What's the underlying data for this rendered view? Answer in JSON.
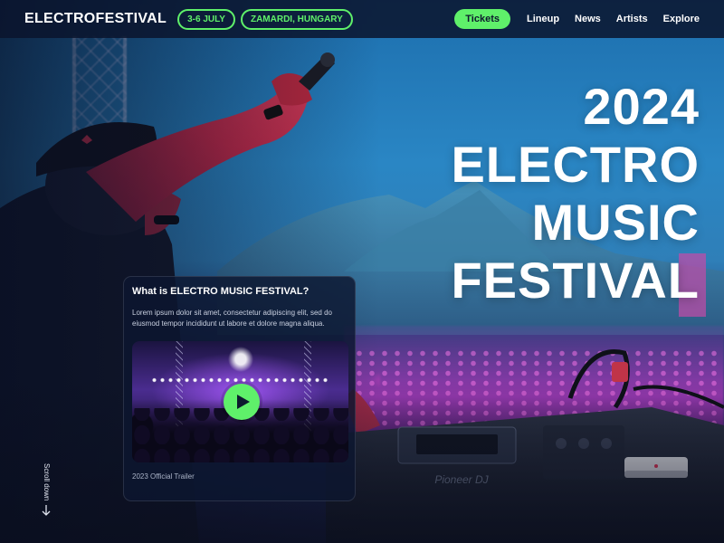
{
  "nav": {
    "logo": "ELECTROFESTIVAL",
    "dates": "3-6 JULY",
    "location": "ZAMARDI, HUNGARY",
    "tickets": "Tickets",
    "links": [
      "Lineup",
      "News",
      "Artists",
      "Explore"
    ]
  },
  "hero": {
    "title_lines": [
      "2024",
      "ELECTRO",
      "MUSIC",
      "FESTIVAL"
    ]
  },
  "card": {
    "title": "What is ELECTRO MUSIC FESTIVAL?",
    "body": "Lorem ipsum dolor sit amet, consectetur adipiscing elit, sed do eiusmod tempor incididunt ut labore et dolore magna aliqua.",
    "caption": "2023 Official Trailer"
  },
  "scroll": {
    "label": "Scroll down"
  },
  "background": {
    "image": "festival-dj-stage",
    "mixer_brand": "Pioneer DJ"
  },
  "colors": {
    "accent": "#5ff06a",
    "nav_bg": "#0a142d",
    "card_bg": "#0c1630",
    "text": "#ffffff"
  },
  "icons": {
    "play": "play-icon",
    "scroll": "arrow-down-icon"
  }
}
